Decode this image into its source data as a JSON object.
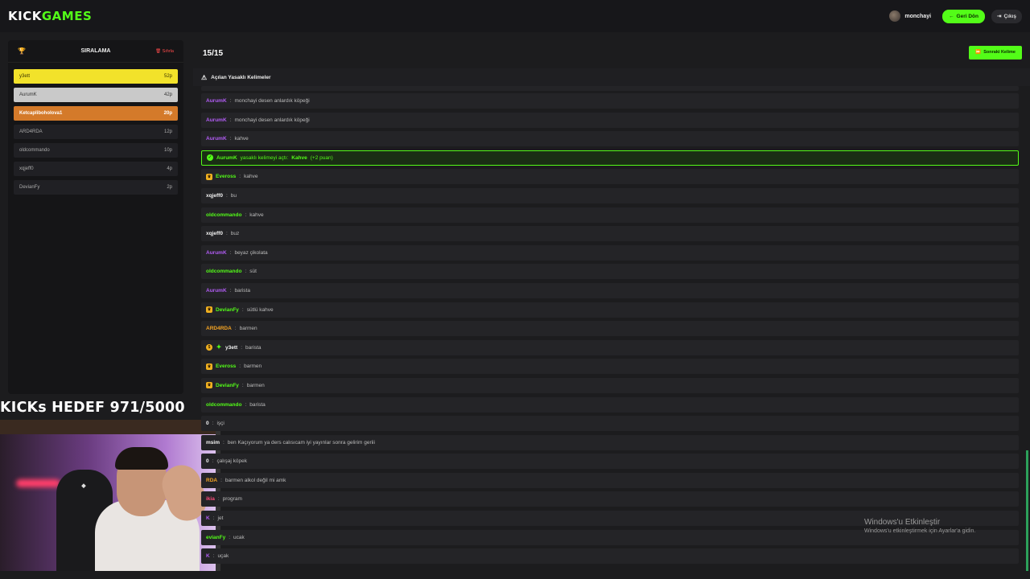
{
  "header": {
    "logo_kick": "KICK",
    "logo_games": "GAMES",
    "username": "monchayi",
    "back_label": "Geri Dön",
    "exit_label": "Çıkış"
  },
  "leaderboard": {
    "title": "SIRALAMA",
    "clear_label": "Sıfırla",
    "entries": [
      {
        "name": "y3ett",
        "score": "52p"
      },
      {
        "name": "AurumK",
        "score": "42p"
      },
      {
        "name": "Ketcapliboholova1",
        "score": "20p"
      },
      {
        "name": "ARD4RDA",
        "score": "12p"
      },
      {
        "name": "oldcommando",
        "score": "10p"
      },
      {
        "name": "xqjeff0",
        "score": "4p"
      },
      {
        "name": "DevianFy",
        "score": "2p"
      }
    ]
  },
  "overlay": {
    "goal_text": "KICKs HEDEF 971/5000"
  },
  "main": {
    "counter": "15/15",
    "next_word_label": "Sonraki Kelime",
    "banned_title": "Açılan Yasaklı Kelimeler"
  },
  "chat": {
    "messages": [
      {
        "name": "AurumK",
        "text": "monchayi desen anlardık köpeği"
      },
      {
        "name": "AurumK",
        "text": "monchayi desen anlardık köpeği"
      },
      {
        "name": "AurumK",
        "text": "kahve"
      },
      {
        "system_name": "AurumK",
        "system_text": "yasaklı kelimeyi açtı:",
        "system_word": "Kahve",
        "system_points": "(+2 puan)"
      },
      {
        "name": "Eveross",
        "text": "kahve"
      },
      {
        "name": "xqjeff0",
        "text": "bu"
      },
      {
        "name": "oldcommando",
        "text": "kahve"
      },
      {
        "name": "xqjeff0",
        "text": "buz"
      },
      {
        "name": "AurumK",
        "text": "beyaz çikolata"
      },
      {
        "name": "oldcommando",
        "text": "süt"
      },
      {
        "name": "AurumK",
        "text": "barista"
      },
      {
        "name": "DevianFy",
        "text": "sütlü kahve"
      },
      {
        "name": "ARD4RDA",
        "text": "barmen"
      },
      {
        "name": "y3ett",
        "text": "barista"
      },
      {
        "name": "Eveross",
        "text": "barmen"
      },
      {
        "name": "DevianFy",
        "text": "barmen"
      },
      {
        "name": "oldcommando",
        "text": "barista"
      },
      {
        "name": "0",
        "text": "işçi"
      },
      {
        "name": "msim",
        "text": "ben Kaçıyorum ya ders calısıcam iyi yayınlar sonra gelirim geriii"
      },
      {
        "name": "0",
        "text": "çalışaj köpek"
      },
      {
        "name": "RDA",
        "text": "barmen alkol değil mi amk"
      },
      {
        "name": "ikia",
        "text": "program"
      },
      {
        "name": "K",
        "text": "jet"
      },
      {
        "name": "evianFy",
        "text": "ucak"
      },
      {
        "name": "K",
        "text": "uçak"
      }
    ]
  },
  "windows": {
    "activate_title": "Windows'u Etkinleştir",
    "activate_sub": "Windows'u etkinleştirmek için Ayarlar'a gidin."
  }
}
